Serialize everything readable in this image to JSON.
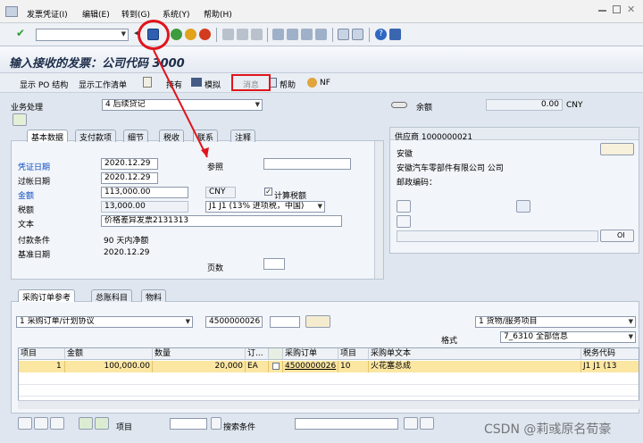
{
  "menu": [
    "发票凭证(I)",
    "编辑(E)",
    "转到(G)",
    "系统(Y)",
    "帮助(H)"
  ],
  "title": "输入接收的发票：公司代码 3000",
  "app_toolbar": {
    "po_structure": "显示 PO 结构",
    "work_list": "显示工作清单",
    "hold": "持有",
    "simulate": "模拟",
    "message": "消息",
    "help": "帮助",
    "nf": "NF"
  },
  "transaction": {
    "label": "业务处理",
    "value": "4 后续贷记"
  },
  "balance": {
    "label": "余额",
    "value": "0.00",
    "currency": "CNY"
  },
  "tabs": [
    "基本数据",
    "支付款项",
    "细节",
    "税收",
    "联系",
    "注释"
  ],
  "basic": {
    "invoice_date_label": "凭证日期",
    "invoice_date": "2020.12.29",
    "reference_label": "参照",
    "reference": "",
    "posting_date_label": "过帐日期",
    "posting_date": "2020.12.29",
    "amount_label": "金额",
    "amount": "113,000.00",
    "amount_currency": "CNY",
    "calc_tax_label": "计算税额",
    "calc_tax_checked": true,
    "tax_label": "税额",
    "tax": "13,000.00",
    "tax_code": "J1 J1 (13% 进项税，中国)",
    "text_label": "文本",
    "text": "价格差异发票2131313",
    "payment_terms_label": "付款条件",
    "payment_terms": "90 天内净额",
    "baseline_label": "基准日期",
    "baseline": "2020.12.29",
    "pages_label": "页数",
    "pages": ""
  },
  "vendor": {
    "header": "供应商 1000000021",
    "line1": "安徽",
    "line2": "安徽汽车零部件有限公司 公司",
    "postal_label": "邮政编码：",
    "oi_label": "OI"
  },
  "lower_tabs": [
    "采购订单参考",
    "总账科目",
    "物料"
  ],
  "po_ref": {
    "doc_type": "1 采购订单/计划协议",
    "po_number": "4500000026",
    "item_type": "1 货物/服务项目",
    "layout_label": "格式",
    "layout": "7_6310 全部信息"
  },
  "grid": {
    "headers": [
      "项目",
      "金额",
      "数量",
      "订...",
      "",
      "采购订单",
      "项目",
      "采购单文本",
      "税务代码"
    ],
    "rows": [
      {
        "item": "1",
        "amount": "100,000.00",
        "qty": "20,000",
        "unit": "EA",
        "po": "4500000026",
        "po_item": "10",
        "text": "火花塞总成",
        "tax": "J1 J1 (13"
      }
    ]
  },
  "bottom": {
    "item_label": "项目",
    "search_label": "搜索条件",
    "item_value": "",
    "search_value": ""
  },
  "watermark": "CSDN @莉彧原名荀豪",
  "colors": {
    "accent": "#0b4cc2",
    "highlight": "#fbe6a2",
    "annotation": "#e0141c"
  }
}
